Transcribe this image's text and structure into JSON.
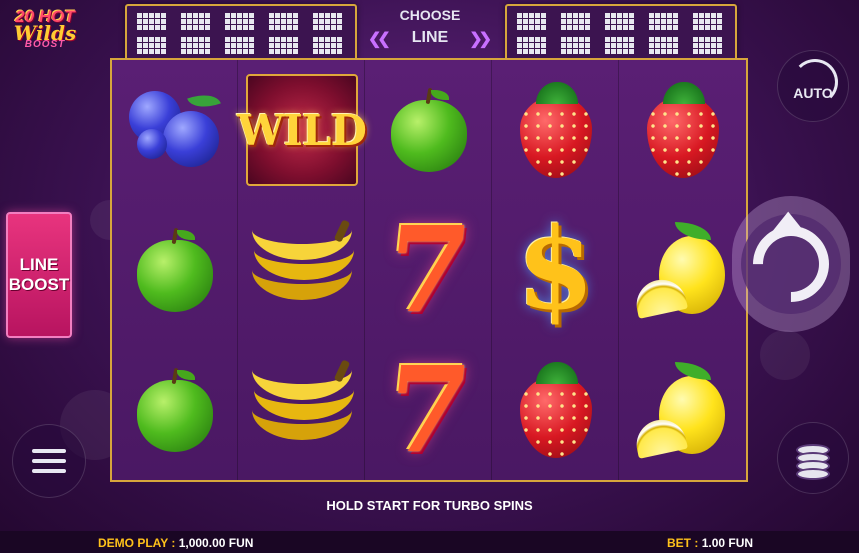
{
  "logo": {
    "line1": "20 HOT",
    "line2": "Wilds",
    "line3": "BOOST"
  },
  "line_selector": {
    "title": "CHOOSE",
    "value": "LINE",
    "prev_icon": "double-chevron-left",
    "next_icon": "double-chevron-right"
  },
  "line_boost": {
    "line1": "LINE",
    "line2": "BOOST"
  },
  "reels": [
    [
      "blueberry",
      "apple",
      "apple"
    ],
    [
      "wild",
      "banana",
      "banana"
    ],
    [
      "apple",
      "seven",
      "seven"
    ],
    [
      "strawberry",
      "dollar",
      "strawberry"
    ],
    [
      "strawberry",
      "lemon",
      "lemon"
    ]
  ],
  "wild_label": "WILD",
  "seven_label": "7",
  "dollar_label": "$",
  "controls": {
    "auto_label": "AUTO",
    "spin_icon": "spin-arrow-icon",
    "menu_icon": "menu-icon",
    "bet_icon": "coins-icon"
  },
  "turbo_hint": "HOLD START FOR TURBO SPINS",
  "footer": {
    "demo_label": "DEMO PLAY :",
    "demo_value": "1,000.00 FUN",
    "bet_label": "BET :",
    "bet_value": "1.00 FUN"
  },
  "colors": {
    "accent_gold": "#d7a63c",
    "background": "#3a1150",
    "line_boost": "#e8347e"
  }
}
